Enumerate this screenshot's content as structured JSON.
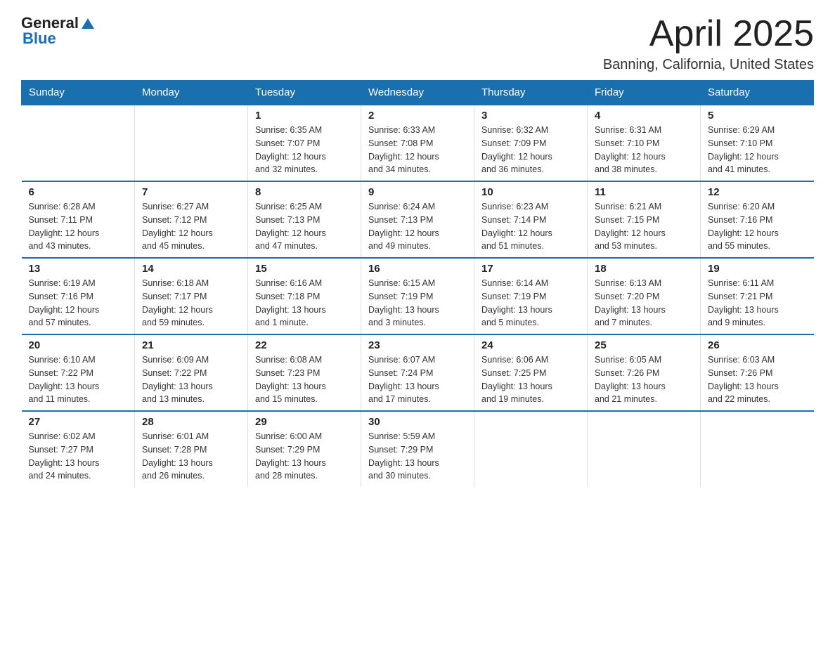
{
  "header": {
    "logo_general": "General",
    "logo_blue": "Blue",
    "title": "April 2025",
    "subtitle": "Banning, California, United States"
  },
  "calendar": {
    "days_of_week": [
      "Sunday",
      "Monday",
      "Tuesday",
      "Wednesday",
      "Thursday",
      "Friday",
      "Saturday"
    ],
    "weeks": [
      [
        {
          "day": "",
          "info": ""
        },
        {
          "day": "",
          "info": ""
        },
        {
          "day": "1",
          "info": "Sunrise: 6:35 AM\nSunset: 7:07 PM\nDaylight: 12 hours\nand 32 minutes."
        },
        {
          "day": "2",
          "info": "Sunrise: 6:33 AM\nSunset: 7:08 PM\nDaylight: 12 hours\nand 34 minutes."
        },
        {
          "day": "3",
          "info": "Sunrise: 6:32 AM\nSunset: 7:09 PM\nDaylight: 12 hours\nand 36 minutes."
        },
        {
          "day": "4",
          "info": "Sunrise: 6:31 AM\nSunset: 7:10 PM\nDaylight: 12 hours\nand 38 minutes."
        },
        {
          "day": "5",
          "info": "Sunrise: 6:29 AM\nSunset: 7:10 PM\nDaylight: 12 hours\nand 41 minutes."
        }
      ],
      [
        {
          "day": "6",
          "info": "Sunrise: 6:28 AM\nSunset: 7:11 PM\nDaylight: 12 hours\nand 43 minutes."
        },
        {
          "day": "7",
          "info": "Sunrise: 6:27 AM\nSunset: 7:12 PM\nDaylight: 12 hours\nand 45 minutes."
        },
        {
          "day": "8",
          "info": "Sunrise: 6:25 AM\nSunset: 7:13 PM\nDaylight: 12 hours\nand 47 minutes."
        },
        {
          "day": "9",
          "info": "Sunrise: 6:24 AM\nSunset: 7:13 PM\nDaylight: 12 hours\nand 49 minutes."
        },
        {
          "day": "10",
          "info": "Sunrise: 6:23 AM\nSunset: 7:14 PM\nDaylight: 12 hours\nand 51 minutes."
        },
        {
          "day": "11",
          "info": "Sunrise: 6:21 AM\nSunset: 7:15 PM\nDaylight: 12 hours\nand 53 minutes."
        },
        {
          "day": "12",
          "info": "Sunrise: 6:20 AM\nSunset: 7:16 PM\nDaylight: 12 hours\nand 55 minutes."
        }
      ],
      [
        {
          "day": "13",
          "info": "Sunrise: 6:19 AM\nSunset: 7:16 PM\nDaylight: 12 hours\nand 57 minutes."
        },
        {
          "day": "14",
          "info": "Sunrise: 6:18 AM\nSunset: 7:17 PM\nDaylight: 12 hours\nand 59 minutes."
        },
        {
          "day": "15",
          "info": "Sunrise: 6:16 AM\nSunset: 7:18 PM\nDaylight: 13 hours\nand 1 minute."
        },
        {
          "day": "16",
          "info": "Sunrise: 6:15 AM\nSunset: 7:19 PM\nDaylight: 13 hours\nand 3 minutes."
        },
        {
          "day": "17",
          "info": "Sunrise: 6:14 AM\nSunset: 7:19 PM\nDaylight: 13 hours\nand 5 minutes."
        },
        {
          "day": "18",
          "info": "Sunrise: 6:13 AM\nSunset: 7:20 PM\nDaylight: 13 hours\nand 7 minutes."
        },
        {
          "day": "19",
          "info": "Sunrise: 6:11 AM\nSunset: 7:21 PM\nDaylight: 13 hours\nand 9 minutes."
        }
      ],
      [
        {
          "day": "20",
          "info": "Sunrise: 6:10 AM\nSunset: 7:22 PM\nDaylight: 13 hours\nand 11 minutes."
        },
        {
          "day": "21",
          "info": "Sunrise: 6:09 AM\nSunset: 7:22 PM\nDaylight: 13 hours\nand 13 minutes."
        },
        {
          "day": "22",
          "info": "Sunrise: 6:08 AM\nSunset: 7:23 PM\nDaylight: 13 hours\nand 15 minutes."
        },
        {
          "day": "23",
          "info": "Sunrise: 6:07 AM\nSunset: 7:24 PM\nDaylight: 13 hours\nand 17 minutes."
        },
        {
          "day": "24",
          "info": "Sunrise: 6:06 AM\nSunset: 7:25 PM\nDaylight: 13 hours\nand 19 minutes."
        },
        {
          "day": "25",
          "info": "Sunrise: 6:05 AM\nSunset: 7:26 PM\nDaylight: 13 hours\nand 21 minutes."
        },
        {
          "day": "26",
          "info": "Sunrise: 6:03 AM\nSunset: 7:26 PM\nDaylight: 13 hours\nand 22 minutes."
        }
      ],
      [
        {
          "day": "27",
          "info": "Sunrise: 6:02 AM\nSunset: 7:27 PM\nDaylight: 13 hours\nand 24 minutes."
        },
        {
          "day": "28",
          "info": "Sunrise: 6:01 AM\nSunset: 7:28 PM\nDaylight: 13 hours\nand 26 minutes."
        },
        {
          "day": "29",
          "info": "Sunrise: 6:00 AM\nSunset: 7:29 PM\nDaylight: 13 hours\nand 28 minutes."
        },
        {
          "day": "30",
          "info": "Sunrise: 5:59 AM\nSunset: 7:29 PM\nDaylight: 13 hours\nand 30 minutes."
        },
        {
          "day": "",
          "info": ""
        },
        {
          "day": "",
          "info": ""
        },
        {
          "day": "",
          "info": ""
        }
      ]
    ]
  }
}
